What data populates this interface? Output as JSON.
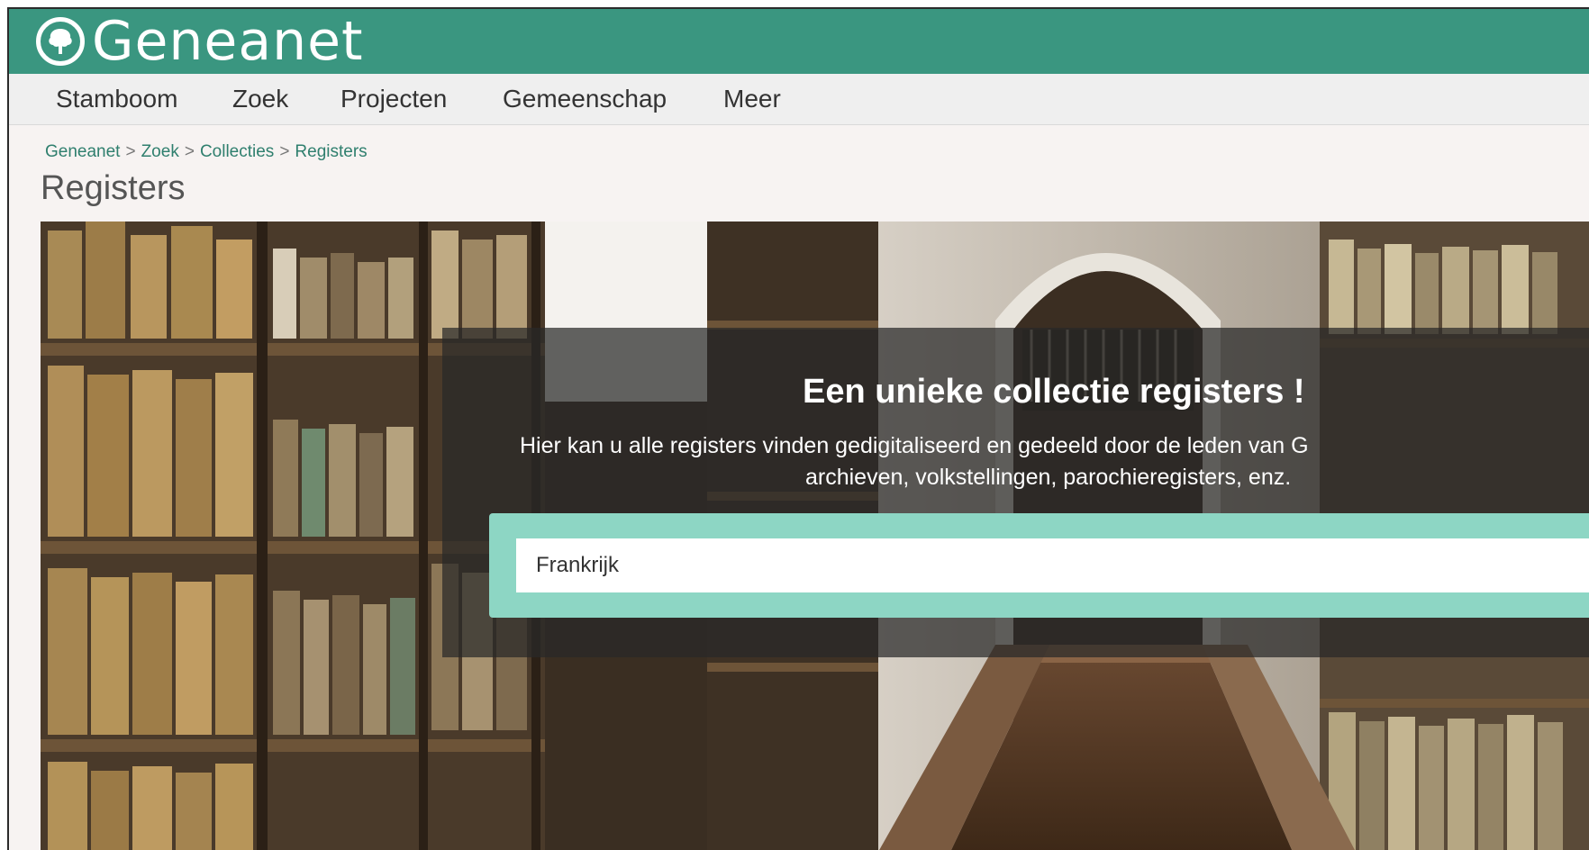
{
  "header": {
    "logo_text": "Geneanet",
    "colors": {
      "brand": "#3a9680",
      "search_frame": "#8dd6c4"
    }
  },
  "nav": {
    "items": [
      {
        "label": "Stamboom"
      },
      {
        "label": "Zoek"
      },
      {
        "label": "Projecten"
      },
      {
        "label": "Gemeenschap"
      },
      {
        "label": "Meer"
      }
    ]
  },
  "breadcrumb": {
    "items": [
      "Geneanet",
      "Zoek",
      "Collecties",
      "Registers"
    ],
    "separator": ">"
  },
  "page": {
    "title": "Registers"
  },
  "hero": {
    "heading": "Een unieke collectie registers !",
    "description_line1": "Hier kan u alle registers vinden gedigitaliseerd en gedeeld door de leden van G",
    "description_line2": "archieven, volkstellingen, parochieregisters, enz.",
    "search_value": "Frankrijk"
  }
}
